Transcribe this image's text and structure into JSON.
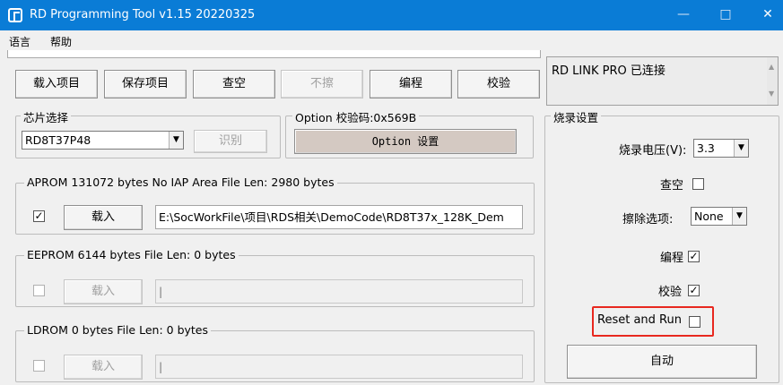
{
  "window": {
    "title": "RD Programming Tool v1.15 20220325",
    "minimize": "—",
    "maximize": "□",
    "close": "✕"
  },
  "menu": {
    "items": [
      "语言",
      "帮助"
    ]
  },
  "toolbar": {
    "load_project": "载入项目",
    "save_project": "保存项目",
    "check_blank": "查空",
    "erase": "不擦",
    "program": "编程",
    "verify": "校验"
  },
  "status": {
    "message": "RD LINK PRO 已连接"
  },
  "chip": {
    "group_label": "芯片选择",
    "selected": "RD8T37P48",
    "identify": "识别"
  },
  "option": {
    "group_label": "Option  校验码:0x569B",
    "button": "Option 设置"
  },
  "aprom": {
    "label": "APROM 131072 bytes  No IAP Area    File Len: 2980 bytes",
    "checked": true,
    "load": "载入",
    "path": "E:\\SocWorkFile\\项目\\RDS相关\\DemoCode\\RD8T37x_128K_Dem"
  },
  "eeprom": {
    "label": "EEPROM 6144 bytes    File Len: 0 bytes",
    "checked": false,
    "load": "载入",
    "path": ""
  },
  "ldrom": {
    "label": "LDROM 0 bytes    File Len: 0 bytes",
    "checked": false,
    "load": "载入",
    "path": ""
  },
  "burn_settings": {
    "group_label": "烧录设置",
    "voltage_label": "烧录电压(V):",
    "voltage": "3.3",
    "check_blank_label": "查空",
    "check_blank": false,
    "erase_label": "擦除选项:",
    "erase_value": "None",
    "program_label": "编程",
    "program": true,
    "verify_label": "校验",
    "verify": true,
    "reset_run_label": "Reset and Run",
    "reset_run": false,
    "auto": "自动"
  },
  "colors": {
    "titlebar": "#0a7cd6",
    "highlight_box": "#e8281f"
  }
}
